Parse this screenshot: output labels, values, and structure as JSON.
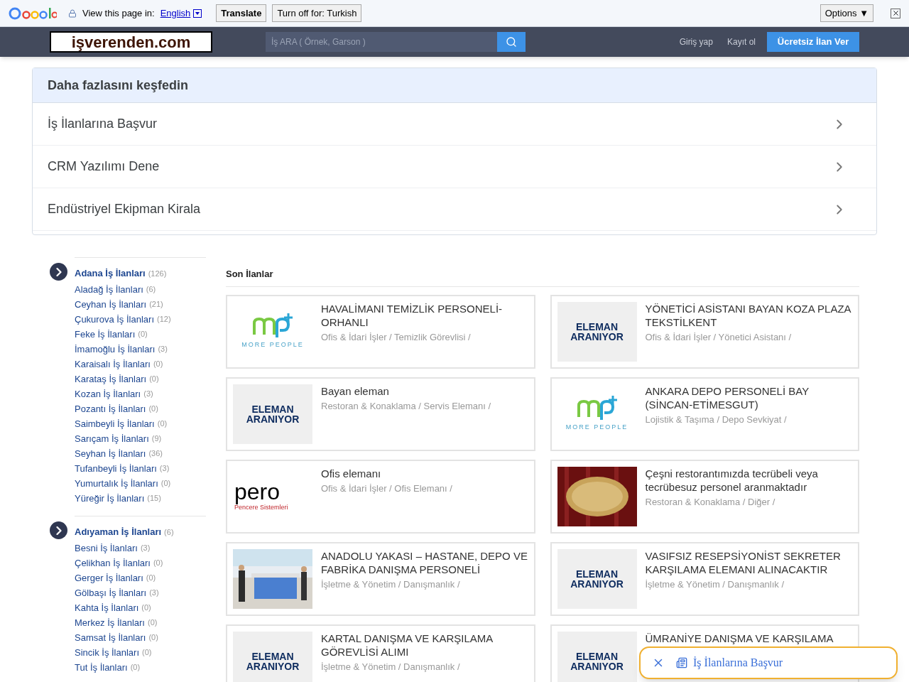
{
  "google_bar": {
    "view_label": "View this page in:",
    "language": "English",
    "translate": "Translate",
    "turn_off": "Turn off for: Turkish",
    "options": "Options ▼"
  },
  "header": {
    "logo": "işverenden.com",
    "search_placeholder": "İş ARA ( Örnek, Garson )",
    "login": "Giriş yap",
    "register": "Kayıt ol",
    "post_button": "Ücretsiz İlan Ver"
  },
  "explore": {
    "title": "Daha fazlasını keşfedin",
    "items": [
      "İş İlanlarına Başvur",
      "CRM Yazılımı Dene",
      "Endüstriyel Ekipman Kirala"
    ]
  },
  "sidebar": {
    "groups": [
      {
        "name": "Adana İş İlanları",
        "count": "(126)",
        "children": [
          {
            "name": "Aladağ İş İlanları",
            "count": "(6)"
          },
          {
            "name": "Ceyhan İş İlanları",
            "count": "(21)"
          },
          {
            "name": "Çukurova İş İlanları",
            "count": "(12)"
          },
          {
            "name": "Feke İş İlanları",
            "count": "(0)"
          },
          {
            "name": "İmamoğlu İş İlanları",
            "count": "(3)"
          },
          {
            "name": "Karaisalı İş İlanları",
            "count": "(0)"
          },
          {
            "name": "Karataş İş İlanları",
            "count": "(0)"
          },
          {
            "name": "Kozan İş İlanları",
            "count": "(3)"
          },
          {
            "name": "Pozantı İş İlanları",
            "count": "(0)"
          },
          {
            "name": "Saimbeyli İş İlanları",
            "count": "(0)"
          },
          {
            "name": "Sarıçam İş İlanları",
            "count": "(9)"
          },
          {
            "name": "Seyhan İş İlanları",
            "count": "(36)"
          },
          {
            "name": "Tufanbeyli İş İlanları",
            "count": "(3)"
          },
          {
            "name": "Yumurtalık İş İlanları",
            "count": "(0)"
          },
          {
            "name": "Yüreğir İş İlanları",
            "count": "(15)"
          }
        ]
      },
      {
        "name": "Adıyaman İş İlanları",
        "count": "(6)",
        "children": [
          {
            "name": "Besni İş İlanları",
            "count": "(3)"
          },
          {
            "name": "Çelikhan İş İlanları",
            "count": "(0)"
          },
          {
            "name": "Gerger İş İlanları",
            "count": "(0)"
          },
          {
            "name": "Gölbaşı İş İlanları",
            "count": "(3)"
          },
          {
            "name": "Kahta İş İlanları",
            "count": "(0)"
          },
          {
            "name": "Merkez İş İlanları",
            "count": "(0)"
          },
          {
            "name": "Samsat İş İlanları",
            "count": "(0)"
          },
          {
            "name": "Sincik İş İlanları",
            "count": "(0)"
          },
          {
            "name": "Tut İş İlanları",
            "count": "(0)"
          }
        ]
      }
    ]
  },
  "listings": {
    "title": "Son İlanlar",
    "cards": [
      {
        "title": "HAVALİMANI TEMİZLİK PERSONELİ-ORHANLI",
        "category": "Ofis & İdari İşler / Temizlik Görevlisi /",
        "thumb": {
          "kind": "morepeople",
          "text": "MORE PEOPLE"
        }
      },
      {
        "title": "YÖNETİCİ ASİSTANI BAYAN KOZA PLAZA TEKSTİLKENT",
        "category": "Ofis & İdari İşler / Yönetici Asistanı /",
        "thumb": {
          "kind": "eleman",
          "text": "ELEMAN ARANIYOR"
        }
      },
      {
        "title": "Bayan eleman",
        "category": "Restoran & Konaklama / Servis Elemanı /",
        "thumb": {
          "kind": "eleman",
          "text": "ELEMAN ARANIYOR"
        }
      },
      {
        "title": "ANKARA DEPO PERSONELİ BAY (SİNCAN-ETİMESGUT)",
        "category": "Lojistik & Taşıma / Depo Sevkiyat /",
        "thumb": {
          "kind": "morepeople",
          "text": "MORE PEOPLE"
        }
      },
      {
        "title": "Ofis elemanı",
        "category": "Ofis & İdari İşler / Ofis Elemanı /",
        "thumb": {
          "kind": "pero",
          "text": "pero",
          "subtext": "Pencere Sistemleri"
        }
      },
      {
        "title": "Çeşni restorantımızda tecrübeli veya tecrübesuz personel aranmaktadır",
        "category": "Restoran & Konaklama / Diğer /"
      },
      {
        "title": "ANADOLU YAKASI – HASTANE, DEPO VE FABRİKA DANIŞMA PERSONELİ",
        "category": "İşletme & Yönetim / Danışmanlık /"
      },
      {
        "title": "VASIFSIZ RESEPSİYONİST SEKRETER KARŞILAMA ELEMANI ALINACAKTIR",
        "category": "İşletme & Yönetim / Danışmanlık /",
        "thumb": {
          "kind": "eleman",
          "text": "ELEMAN ARANIYOR"
        }
      },
      {
        "title": "KARTAL DANIŞMA VE KARŞILAMA GÖREVLİSİ ALIMI",
        "category": "İşletme & Yönetim / Danışmanlık /",
        "thumb": {
          "kind": "eleman",
          "text": "ELEMAN ARANIYOR"
        }
      },
      {
        "title": "ÜMRANİYE DANIŞMA VE KARŞILAMA",
        "thumb": {
          "kind": "eleman",
          "text": "ELEMAN ARANIYOR"
        }
      }
    ]
  },
  "popup": {
    "label": "İş İlanlarına Başvur"
  }
}
